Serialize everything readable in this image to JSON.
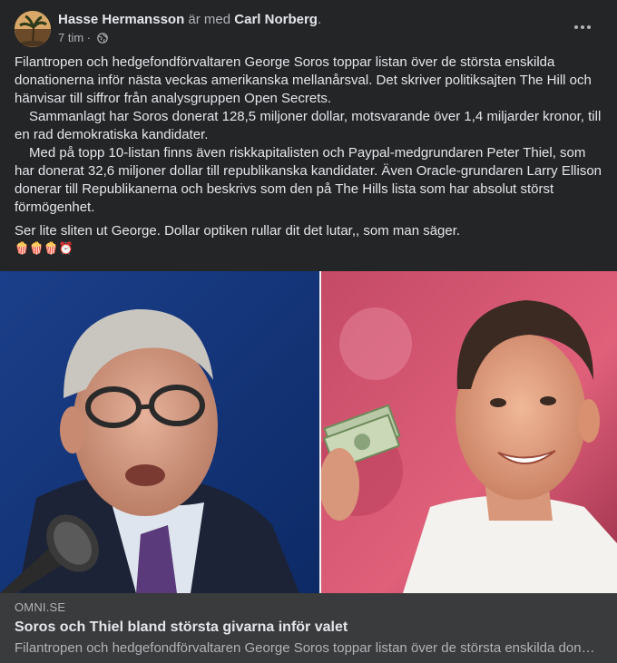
{
  "post": {
    "author": "Hasse Hermansson",
    "with_text": "är med",
    "tagged": "Carl Norberg",
    "tagged_suffix": ".",
    "time": "7 tim",
    "time_sep": "·",
    "privacy_icon": "globe-icon",
    "more_icon": "more-horizontal-icon",
    "paragraphs": [
      "Filantropen och hedgefondförvaltaren George Soros toppar listan över de största enskilda donationerna inför nästa veckas amerikanska mellanårsval. Det skriver politiksajten The Hill och hänvisar till siffror från analysgruppen Open Secrets.",
      "Sammanlagt har Soros donerat 128,5 miljoner dollar, motsvarande över 1,4 miljarder kronor, till en rad demokratiska kandidater.",
      "Med på topp 10-listan finns även riskkapitalisten och Paypal-medgrundaren Peter Thiel, som har donerat 32,6 miljoner dollar till republikanska kandidater. Även Oracle-grundaren Larry Ellison donerar till Republikanerna och beskrivs som den på The Hills lista som har absolut störst förmögenhet."
    ],
    "comment": "Ser lite sliten ut George. Dollar optiken rullar dit det lutar,, som man säger.",
    "emojis": "🍿🍿🍿⏰"
  },
  "link": {
    "domain": "OMNI.SE",
    "title": "Soros och Thiel bland största givarna inför valet",
    "description": "Filantropen och hedgefondförvaltaren George Soros toppar listan över de största enskilda donationerna inför nästa veckas amerikanska mellanårsval. Det skriver politiksajten The Hill och hänvisar till siffror från analysgruppen Open Secrets."
  },
  "colors": {
    "background": "#242526",
    "link_box": "#3a3b3c",
    "text": "#e4e6eb",
    "muted": "#b0b3b8"
  }
}
